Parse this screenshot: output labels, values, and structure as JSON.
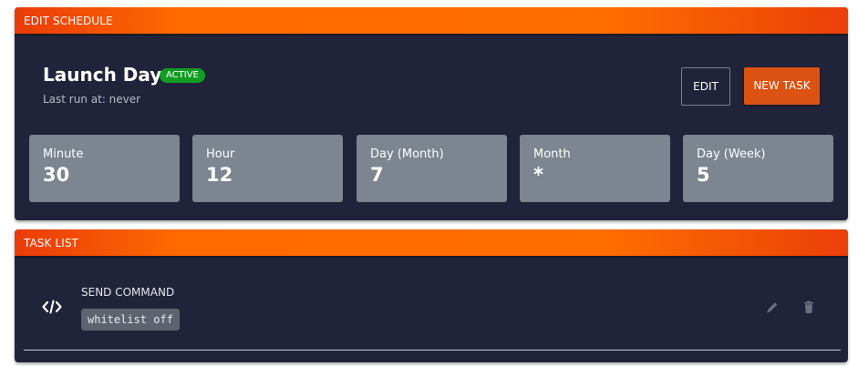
{
  "schedule_panel": {
    "header": "EDIT SCHEDULE",
    "title": "Launch Day",
    "status_badge": "ACTIVE",
    "last_run": "Last run at: never",
    "buttons": {
      "edit": "EDIT",
      "new_task": "NEW TASK"
    },
    "cron": [
      {
        "label": "Minute",
        "value": "30"
      },
      {
        "label": "Hour",
        "value": "12"
      },
      {
        "label": "Day (Month)",
        "value": "7"
      },
      {
        "label": "Month",
        "value": "*"
      },
      {
        "label": "Day (Week)",
        "value": "5"
      }
    ]
  },
  "task_panel": {
    "header": "TASK LIST",
    "tasks": [
      {
        "icon": "code-icon",
        "type": "SEND COMMAND",
        "payload": "whitelist off",
        "actions": [
          "pencil-icon",
          "trash-icon"
        ]
      }
    ]
  },
  "colors": {
    "header_gradient_start": "#ea3b0a",
    "header_gradient_mid": "#ff6f00",
    "panel_bg": "#21233a",
    "active_badge": "#119c22",
    "new_task_button": "#dc5212",
    "cron_box": "#7c8590"
  }
}
